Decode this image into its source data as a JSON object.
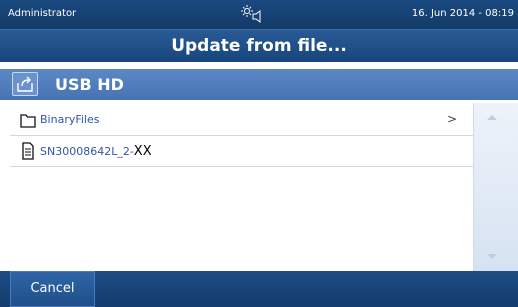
{
  "status_bar": {
    "user": "Administrator",
    "icons": [
      "brightness-icon",
      "speaker-icon"
    ],
    "datetime": "16. Jun 2014 - 08:19"
  },
  "dialog": {
    "title": "Update from file..."
  },
  "path": {
    "up_icon": "folder-up-icon",
    "location": "USB HD"
  },
  "files": [
    {
      "name": "BinaryFiles",
      "suffix": "",
      "type": "folder",
      "icon": "folder-icon",
      "chevron": ">"
    },
    {
      "name": "SN30008642L_2-",
      "suffix": "XX",
      "type": "file",
      "icon": "document-icon",
      "chevron": ""
    }
  ],
  "footer": {
    "cancel_label": "Cancel"
  },
  "colors": {
    "header": "#17467d",
    "path_bar": "#4673b3",
    "link_text": "#2f56a6"
  }
}
